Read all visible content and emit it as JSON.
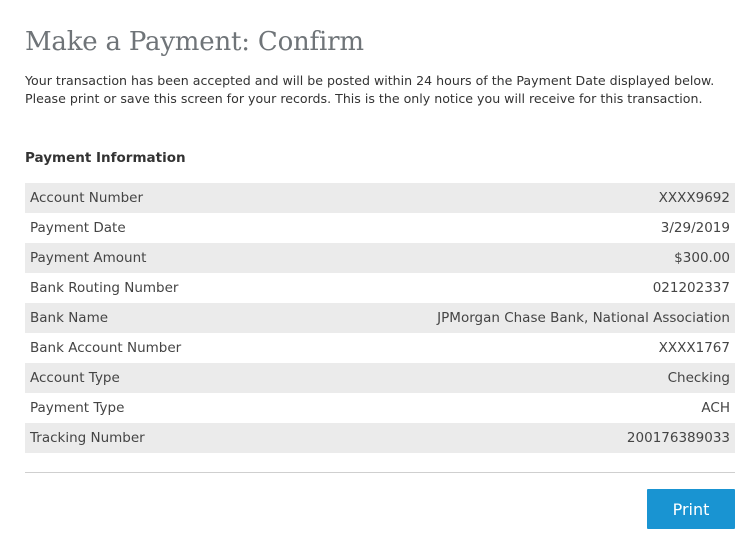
{
  "page": {
    "title": "Make a Payment: Confirm",
    "intro": "Your transaction has been accepted and will be posted within 24 hours of the Payment Date displayed below. Please print or save this screen for your records. This is the only notice you will receive for this transaction."
  },
  "payment_info": {
    "heading": "Payment Information",
    "rows": [
      {
        "label": "Account Number",
        "value": "XXXX9692"
      },
      {
        "label": "Payment Date",
        "value": "3/29/2019"
      },
      {
        "label": "Payment Amount",
        "value": "$300.00"
      },
      {
        "label": "Bank Routing Number",
        "value": "021202337"
      },
      {
        "label": "Bank Name",
        "value": "JPMorgan Chase Bank, National Association"
      },
      {
        "label": "Bank Account Number",
        "value": "XXXX1767"
      },
      {
        "label": "Account Type",
        "value": "Checking"
      },
      {
        "label": "Payment Type",
        "value": "ACH"
      },
      {
        "label": "Tracking Number",
        "value": "200176389033"
      }
    ]
  },
  "actions": {
    "print_label": "Print"
  },
  "colors": {
    "primary_button": "#1994d2",
    "row_stripe": "#ebebeb",
    "title": "#6f7478"
  }
}
